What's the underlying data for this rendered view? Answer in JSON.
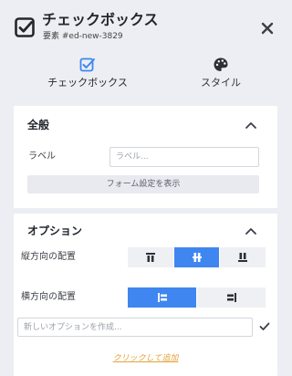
{
  "header": {
    "title": "チェックボックス",
    "subtitle": "要素 #ed-new-3829",
    "icon": "checkbox-icon",
    "close_icon": "close-icon"
  },
  "tabs": [
    {
      "label": "チェックボックス",
      "icon": "checkbox-icon",
      "active": true
    },
    {
      "label": "スタイル",
      "icon": "palette-icon",
      "active": false
    }
  ],
  "general": {
    "title": "全般",
    "label_field_label": "ラベル",
    "label_field_placeholder": "ラベル...",
    "label_field_value": "",
    "form_settings_button": "フォーム設定を表示"
  },
  "options": {
    "title": "オプション",
    "vertical_label": "縦方向の配置",
    "vertical_selected": "center",
    "horizontal_label": "横方向の配置",
    "horizontal_selected": "left",
    "new_option_placeholder": "新しいオプションを作成...",
    "new_option_value": "",
    "add_link": "クリックして追加"
  },
  "colors": {
    "accent": "#3f86f0",
    "link": "#e3a33a",
    "background": "#eceef3"
  }
}
